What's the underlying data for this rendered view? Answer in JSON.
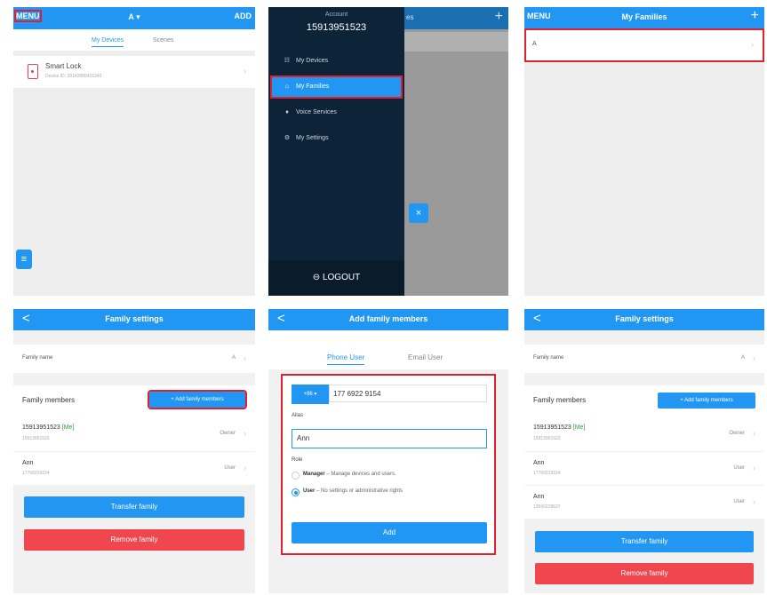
{
  "panel1": {
    "menu": "MENU",
    "title": "A ▾",
    "add": "ADD",
    "tabs": [
      "My Devices",
      "Scenes"
    ],
    "device": {
      "name": "Smart Lock",
      "id": "Device ID: 39142885415343"
    },
    "fab_icon": "≡"
  },
  "panel2": {
    "account_label": "Account",
    "account_number": "15913951523",
    "items": [
      {
        "icon": "☷",
        "label": "My Devices"
      },
      {
        "icon": "⌂",
        "label": "My Families"
      },
      {
        "icon": "♦",
        "label": "Voice Services"
      },
      {
        "icon": "⚙",
        "label": "My Settings"
      }
    ],
    "logout": "⊖ LOGOUT",
    "underlay_fragment": "es",
    "plus": "+",
    "close": "×"
  },
  "panel3": {
    "menu": "MENU",
    "title": "My Families",
    "plus": "+",
    "family": "A"
  },
  "settings": {
    "title": "Family settings",
    "back": "<",
    "family_name_label": "Family name",
    "family_name_value": "A",
    "members_label": "Family members",
    "add_members": "+ Add family members",
    "members_before": [
      {
        "phone": "15913951523",
        "me": "[Me]",
        "sub": "15913951523",
        "role": "Owner"
      },
      {
        "phone": "Ann",
        "me": "",
        "sub": "17769229154",
        "role": "User"
      }
    ],
    "members_after": [
      {
        "phone": "15913951523",
        "me": "[Me]",
        "sub": "15913951523",
        "role": "Owner"
      },
      {
        "phone": "Ann",
        "me": "",
        "sub": "17769229154",
        "role": "User"
      },
      {
        "phone": "Ann",
        "me": "",
        "sub": "13560228637",
        "role": "User"
      }
    ],
    "transfer": "Transfer family",
    "remove": "Remove family"
  },
  "addmember": {
    "title": "Add family members",
    "back": "<",
    "tabs": [
      "Phone User",
      "Email User"
    ],
    "country_code": "+86 ▾",
    "phone": "177 6922 9154",
    "alias_label": "Alias",
    "alias_value": "Ann",
    "role_label": "Role",
    "manager_title": "Manager",
    "manager_desc": " – Manage devices and users.",
    "user_title": "User",
    "user_desc": " – No settings or administrative rights",
    "add_button": "Add"
  },
  "colors": {
    "primary": "#2196f3",
    "danger": "#f0474f",
    "highlight": "#e02030",
    "drawer": "#0d2338"
  }
}
